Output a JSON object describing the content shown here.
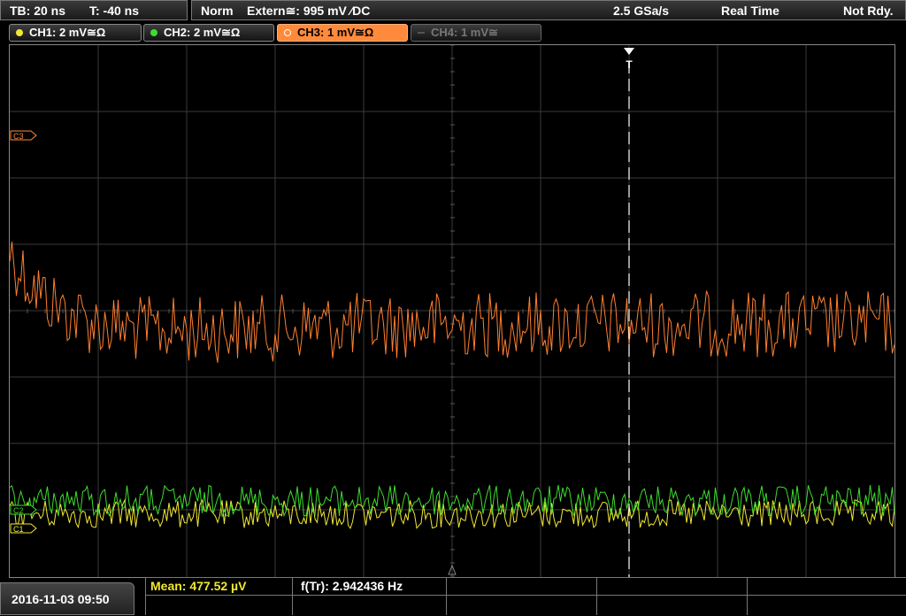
{
  "timebase": {
    "tb": "TB: 20 ns",
    "trig_pos": "T: -40 ns"
  },
  "status": {
    "mode": "Norm",
    "trigger": "Extern≅: 995 mV ⁄DC",
    "sample_rate": "2.5 GSa/s",
    "acq": "Real Time",
    "state": "Not Rdy."
  },
  "channels": [
    {
      "label": "CH1: 2 mV≅Ω",
      "color": "#f2e830"
    },
    {
      "label": "CH2: 2 mV≅Ω",
      "color": "#3ddc2f"
    },
    {
      "label": "CH3: 1 mV≅Ω",
      "color": "#ff8a3c"
    },
    {
      "label": "CH4: 1 mV≅",
      "color": "#555555"
    }
  ],
  "markers": {
    "ch3": "C3",
    "ch2": "C2",
    "ch1": "C1",
    "trigger": "T"
  },
  "footer": {
    "datetime": "2016-11-03 09:50",
    "mean": "Mean: 477.52 µV",
    "freq": "f(Tr): 2.942436 Hz"
  },
  "colors": {
    "ch1": "#f2e830",
    "ch2": "#3ddc2f",
    "ch3": "#ff7f30",
    "grid": "#3a3a3a"
  }
}
